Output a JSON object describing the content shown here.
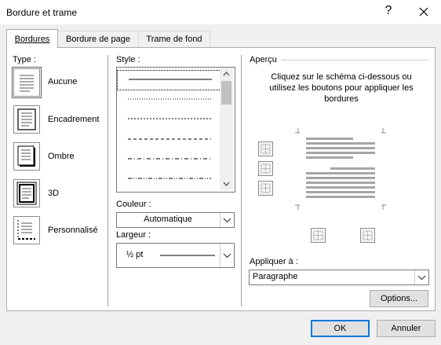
{
  "window": {
    "title": "Bordure et trame",
    "help_icon": "?",
    "close_icon": "close-icon"
  },
  "tabs": [
    {
      "label": "Bordures",
      "active": true
    },
    {
      "label": "Bordure de page",
      "active": false
    },
    {
      "label": "Trame de fond",
      "active": false
    }
  ],
  "type_section": {
    "label": "Type :",
    "items": [
      {
        "label": "Aucune",
        "icon": "border-none-icon",
        "selected": true
      },
      {
        "label": "Encadrement",
        "icon": "border-box-icon",
        "selected": false
      },
      {
        "label": "Ombre",
        "icon": "border-shadow-icon",
        "selected": false
      },
      {
        "label": "3D",
        "icon": "border-3d-icon",
        "selected": false
      },
      {
        "label": "Personnalisé",
        "icon": "border-custom-icon",
        "selected": false
      }
    ]
  },
  "style_section": {
    "label": "Style :",
    "styles": [
      "solid",
      "dotted",
      "dashed-small",
      "dashed",
      "dash-dot",
      "dash-dot-dot"
    ],
    "color_label": "Couleur :",
    "color_value": "Automatique",
    "width_label": "Largeur :",
    "width_value": "½ pt"
  },
  "preview_section": {
    "label": "Aperçu",
    "instructions": "Cliquez sur le schéma ci-dessous ou utilisez les boutons pour appliquer les bordures",
    "apply_label": "Appliquer à :",
    "apply_value": "Paragraphe",
    "options_button": "Options..."
  },
  "footer": {
    "ok": "OK",
    "cancel": "Annuler"
  },
  "colors": {
    "accent": "#0078d7",
    "panel_border": "#adadad",
    "background": "#f0f0f0"
  }
}
